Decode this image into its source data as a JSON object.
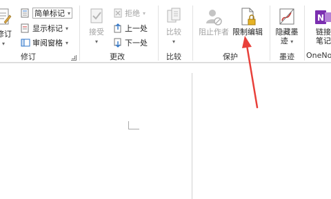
{
  "revision_group": {
    "track_changes_label": "修订",
    "simple_markup_select": "简单标记",
    "show_markup_label": "显示标记",
    "reviewing_pane_label": "审阅窗格",
    "group_label": "修订"
  },
  "changes_group": {
    "accept_label": "接受",
    "reject_label": "拒绝",
    "previous_label": "上一处",
    "next_label": "下一处",
    "group_label": "更改"
  },
  "compare_group": {
    "compare_label": "比较",
    "group_label": "比较"
  },
  "protect_group": {
    "block_authors_label": "阻止作者",
    "restrict_editing_label": "限制编辑",
    "group_label": "保护"
  },
  "ink_group": {
    "hide_ink_label_line1": "隐藏墨",
    "hide_ink_label_line2": "迹",
    "group_label": "墨迹"
  },
  "onenote_group": {
    "linked_notes_line1": "链接",
    "linked_notes_line2": "笔记",
    "group_label": "OneNote"
  },
  "colors": {
    "accent_red": "#e8403a",
    "onenote_purple": "#7b2fb0",
    "disabled_gray": "#a3a3a3"
  }
}
